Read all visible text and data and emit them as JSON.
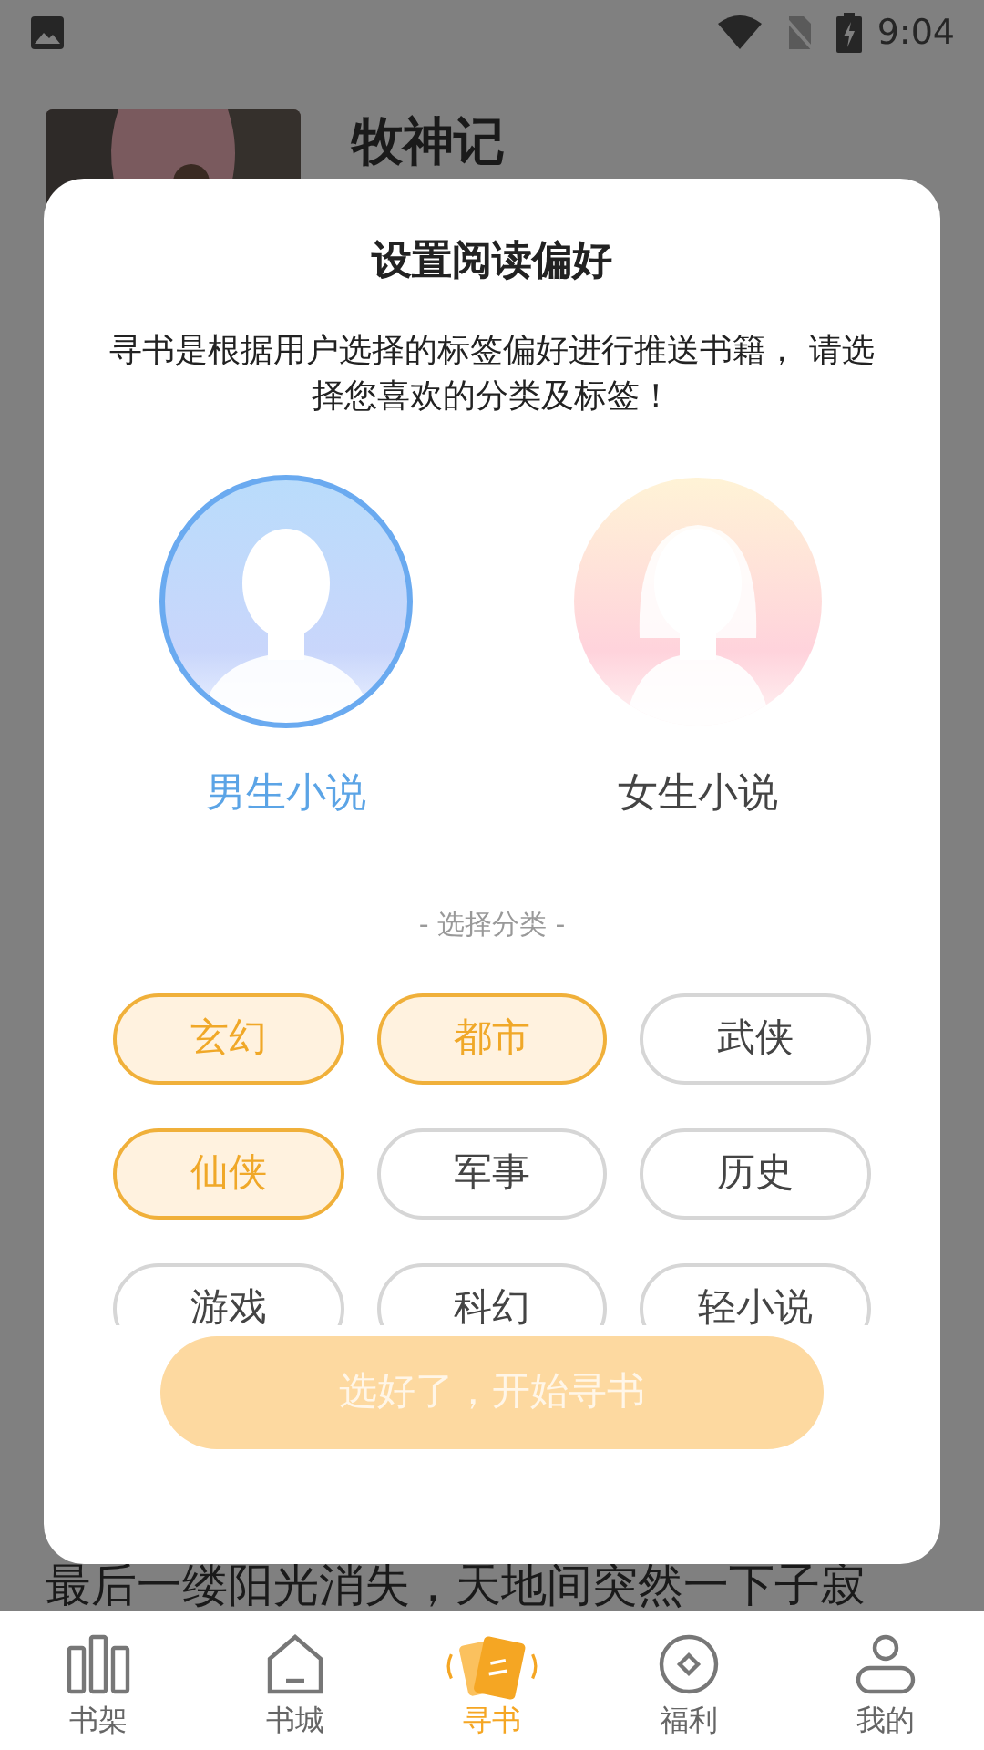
{
  "status_bar": {
    "time": "9:04"
  },
  "book": {
    "title": "牧神记",
    "excerpt": "最后一缕阳光消失，天地间突然一下子寂"
  },
  "dialog": {
    "title": "设置阅读偏好",
    "description": "寻书是根据用户选择的标签偏好进行推送书籍， 请选择您喜欢的分类及标签！",
    "genders": [
      {
        "kind": "male",
        "label": "男生小说",
        "selected": true
      },
      {
        "kind": "female",
        "label": "女生小说",
        "selected": false
      }
    ],
    "section_label": "- 选择分类 -",
    "tags": [
      {
        "label": "玄幻",
        "selected": true
      },
      {
        "label": "都市",
        "selected": true
      },
      {
        "label": "武侠",
        "selected": false
      },
      {
        "label": "仙侠",
        "selected": true
      },
      {
        "label": "军事",
        "selected": false
      },
      {
        "label": "历史",
        "selected": false
      },
      {
        "label": "游戏",
        "selected": false
      },
      {
        "label": "科幻",
        "selected": false
      },
      {
        "label": "轻小说",
        "selected": false
      }
    ],
    "confirm_button": {
      "label": "选好了，开始寻书",
      "disabled": true
    }
  },
  "tab_bar": [
    {
      "kind": "shelf",
      "label": "书架",
      "selected": false
    },
    {
      "kind": "store",
      "label": "书城",
      "selected": false
    },
    {
      "kind": "find",
      "label": "寻书",
      "selected": true
    },
    {
      "kind": "welfare",
      "label": "福利",
      "selected": false
    },
    {
      "kind": "me",
      "label": "我的",
      "selected": false
    }
  ]
}
